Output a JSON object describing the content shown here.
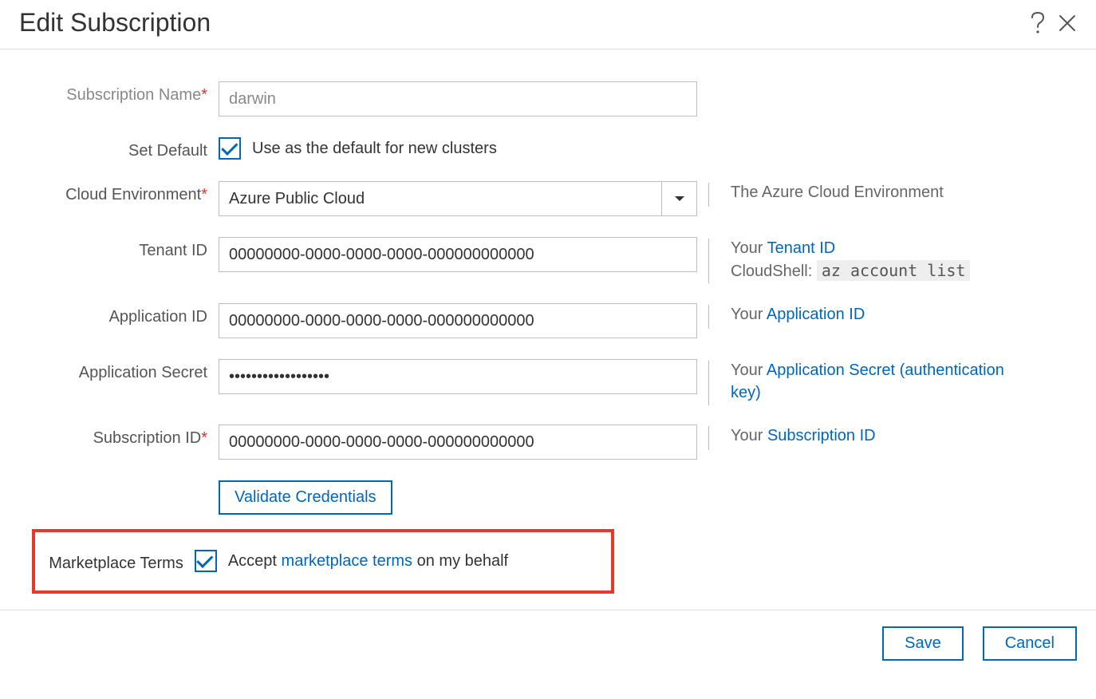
{
  "header": {
    "title": "Edit Subscription"
  },
  "fields": {
    "subscription_name": {
      "label": "Subscription Name",
      "required_mark": "*",
      "value": "darwin"
    },
    "set_default": {
      "label": "Set Default",
      "checkbox_label": "Use as the default for new clusters"
    },
    "cloud_env": {
      "label": "Cloud Environment",
      "required_mark": "*",
      "selected": "Azure Public Cloud",
      "help": "The Azure Cloud Environment"
    },
    "tenant_id": {
      "label": "Tenant ID",
      "value": "00000000-0000-0000-0000-000000000000",
      "help_prefix": "Your ",
      "help_link": "Tenant ID",
      "help_line2_prefix": "CloudShell: ",
      "help_line2_code": "az account list"
    },
    "application_id": {
      "label": "Application ID",
      "value": "00000000-0000-0000-0000-000000000000",
      "help_prefix": "Your ",
      "help_link": "Application ID"
    },
    "application_secret": {
      "label": "Application Secret",
      "value": "••••••••••••••••••",
      "help_prefix": "Your ",
      "help_link": "Application Secret (authentication key)"
    },
    "subscription_id": {
      "label": "Subscription ID",
      "required_mark": "*",
      "value": "00000000-0000-0000-0000-000000000000",
      "help_prefix": "Your ",
      "help_link": "Subscription ID"
    },
    "validate_button": "Validate Credentials",
    "marketplace_terms": {
      "label": "Marketplace Terms",
      "text_before": "Accept ",
      "link": "marketplace terms",
      "text_after": " on my behalf"
    }
  },
  "footer": {
    "save": "Save",
    "cancel": "Cancel"
  }
}
